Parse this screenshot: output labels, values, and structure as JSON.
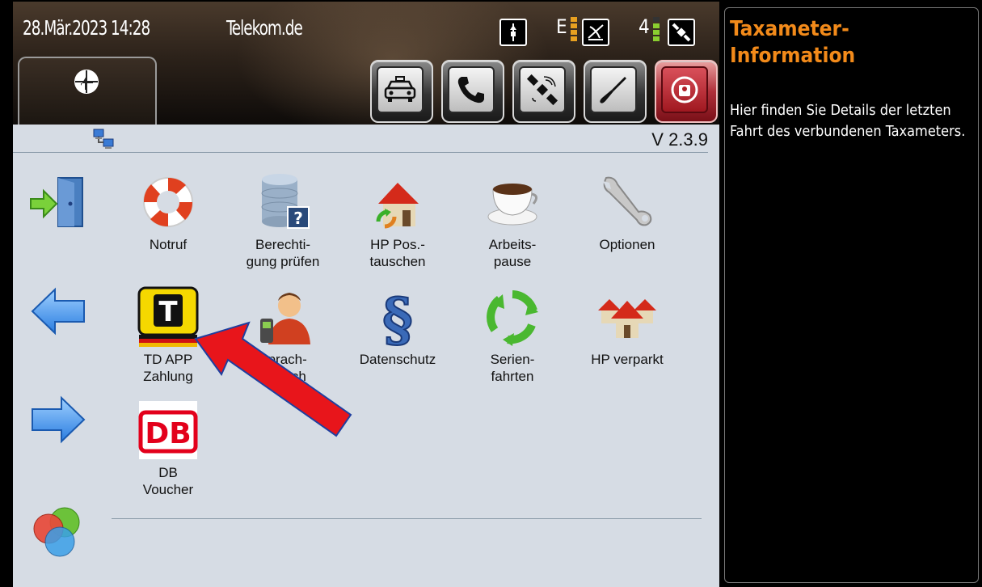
{
  "status": {
    "datetime": "28.Mär.2023 14:28",
    "carrier": "Telekom.de",
    "indicator_e_letter": "E",
    "indicator_num": "4"
  },
  "toolbar": {
    "buttons": [
      {
        "name": "taxi-button",
        "icon": "taxi-icon"
      },
      {
        "name": "phone-button",
        "icon": "phone-icon"
      },
      {
        "name": "satellite-button",
        "icon": "satellite-icon"
      },
      {
        "name": "tools-button",
        "icon": "screwdriver-icon"
      },
      {
        "name": "emergency-button",
        "icon": "alarm-icon"
      }
    ]
  },
  "main": {
    "version": "V 2.3.9",
    "apps": {
      "notruf": "Notruf",
      "berechtigung": "Berechti-\ngung prüfen",
      "hp_pos": "HP Pos.-\ntauschen",
      "arbeitspause": "Arbeits-\npause",
      "optionen": "Optionen",
      "td_app": "TD APP\nZahlung",
      "sprach": "Sprach-\nwunsch",
      "datenschutz": "Datenschutz",
      "serienfahrten": "Serien-\nfahrten",
      "hp_verparkt": "HP verparkt",
      "db_voucher": "DB\nVoucher",
      "db_logo_text": "DB",
      "td_logo_text": "T"
    }
  },
  "info": {
    "title": "Taxameter-\nInformation",
    "text": "Hier finden Sie Details der letzten Fahrt des verbundenen Taxameters."
  },
  "colors": {
    "info_title": "#f28a1a",
    "annotation_arrow": "#e8151b"
  }
}
